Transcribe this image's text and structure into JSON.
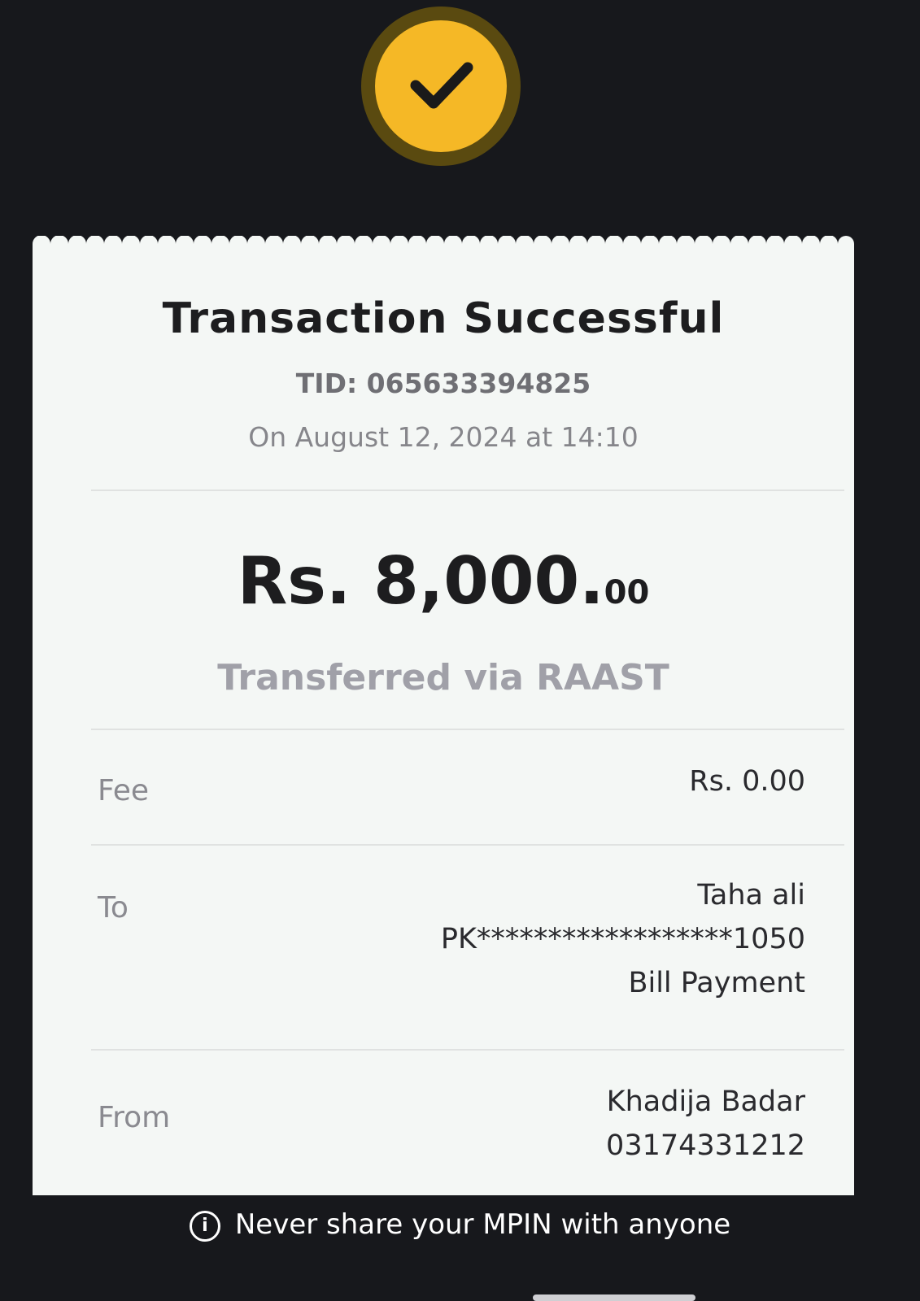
{
  "receipt": {
    "title": "Transaction Successful",
    "tid": "TID: 065633394825",
    "date": "On August 12, 2024 at 14:10",
    "amount_main": "Rs. 8,000.",
    "amount_cents": "00",
    "transfer_method": "Transferred via RAAST",
    "fee": {
      "label": "Fee",
      "value": "Rs. 0.00"
    },
    "to": {
      "label": "To",
      "name": "Taha ali",
      "account": "PK******************1050",
      "purpose": "Bill Payment"
    },
    "from": {
      "label": "From",
      "name": "Khadija Badar",
      "phone": "03174331212"
    }
  },
  "footer": {
    "info_glyph": "i",
    "message": "Never share your MPIN with anyone"
  },
  "colors": {
    "accent": "#f5b826",
    "background": "#17181c",
    "receipt": "#f4f7f5"
  },
  "icons": {
    "status": "checkmark-icon",
    "footer": "info-icon"
  }
}
